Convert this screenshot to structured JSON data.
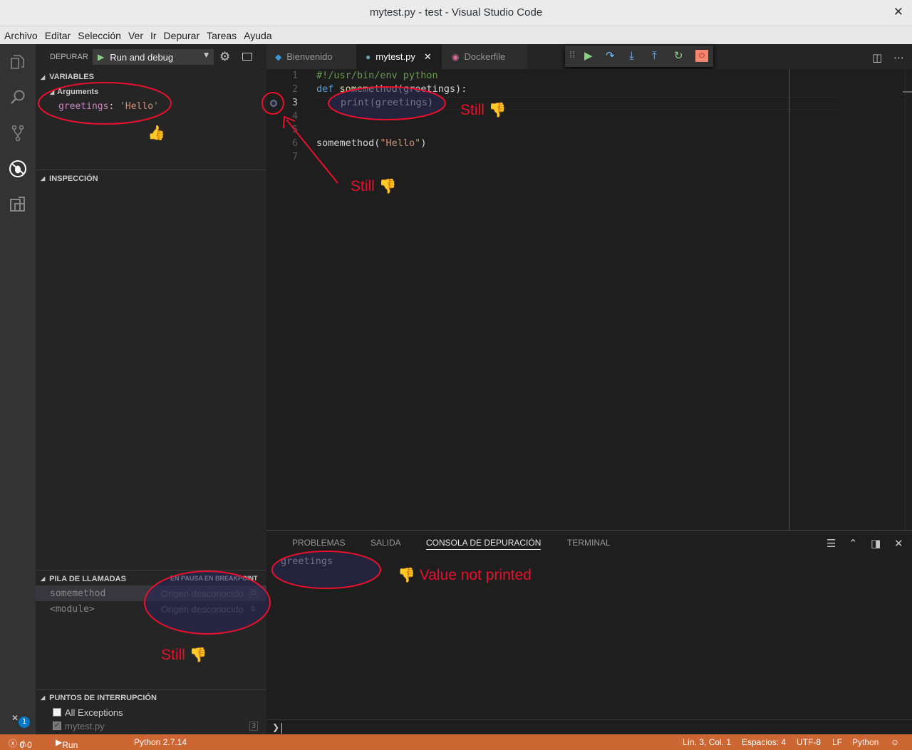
{
  "window": {
    "title": "mytest.py - test - Visual Studio Code",
    "close_glyph": "✕"
  },
  "menu": [
    "Archivo",
    "Editar",
    "Selección",
    "Ver",
    "Ir",
    "Depurar",
    "Tareas",
    "Ayuda"
  ],
  "activity_bar": {
    "icons": [
      "files-icon",
      "search-icon",
      "source-control-icon",
      "debug-icon",
      "extensions-icon"
    ],
    "bottom_badge": "1"
  },
  "debug_header": {
    "label": "DEPURAR",
    "config_name": "Run and debug"
  },
  "variables": {
    "header": "VARIABLES",
    "scope": "Arguments",
    "name": "greetings",
    "separator": ": ",
    "value": "'Hello'"
  },
  "watch": {
    "header": "INSPECCIÓN"
  },
  "call_stack": {
    "header": "PILA DE LLAMADAS",
    "status": "EN PAUSA EN BREAKPOINT",
    "frames": [
      {
        "name": "somemethod",
        "source": "Origen desconocido",
        "line": "0"
      },
      {
        "name": "<module>",
        "source": "Origen desconocido",
        "line": "0"
      }
    ]
  },
  "breakpoints": {
    "header": "PUNTOS DE INTERRUPCIÓN",
    "items": [
      {
        "label": "All Exceptions",
        "checked": false
      },
      {
        "label": "mytest.py",
        "checked": true,
        "count": "3"
      }
    ]
  },
  "tabs": [
    {
      "label": "Bienvenido",
      "icon": "vscode-icon",
      "active": false
    },
    {
      "label": "mytest.py",
      "icon": "python-icon",
      "active": true
    },
    {
      "label": "Dockerfile",
      "icon": "docker-icon",
      "active": false
    }
  ],
  "debug_toolbar": [
    "drag-handle-icon",
    "continue-icon",
    "step-over-icon",
    "step-into-icon",
    "step-out-icon",
    "restart-icon",
    "stop-icon"
  ],
  "editor": {
    "line_numbers": [
      "1",
      "2",
      "3",
      "4",
      "5",
      "6",
      "7"
    ],
    "lines": {
      "l1": "#!/usr/bin/env python",
      "l2_kw": "def",
      "l2_fn": "somemethod",
      "l2_rest": "(greetings):",
      "l3": "print(greetings)",
      "l6_fn": "somemethod(",
      "l6_str": "\"Hello\"",
      "l6_end": ")"
    }
  },
  "panel": {
    "tabs": [
      "PROBLEMAS",
      "SALIDA",
      "CONSOLA DE DEPURACIÓN",
      "TERMINAL"
    ],
    "active_tab": "CONSOLA DE DEPURACIÓN",
    "console_output": "greetings",
    "prompt": "❯"
  },
  "status_bar": {
    "errors": "0",
    "warnings": "0",
    "debug_config": "Run and debug",
    "interpreter": "Python 2.7.14",
    "position": "Lín. 3, Col. 1",
    "indent": "Espacios: 4",
    "encoding": "UTF-8",
    "eol": "LF",
    "language": "Python"
  },
  "annotations": {
    "still_1": "Still",
    "still_2": "Still",
    "still_3": "Still",
    "value_not_printed": "Value not printed",
    "thumbs_up": "👍",
    "thumbs_down": "👎",
    "color": "#e8112d"
  },
  "colors": {
    "status_bar": "#cc6633",
    "activity_bar": "#333333",
    "sidebar": "#252526",
    "editor": "#1e1e1e",
    "accent": "#007acc"
  }
}
